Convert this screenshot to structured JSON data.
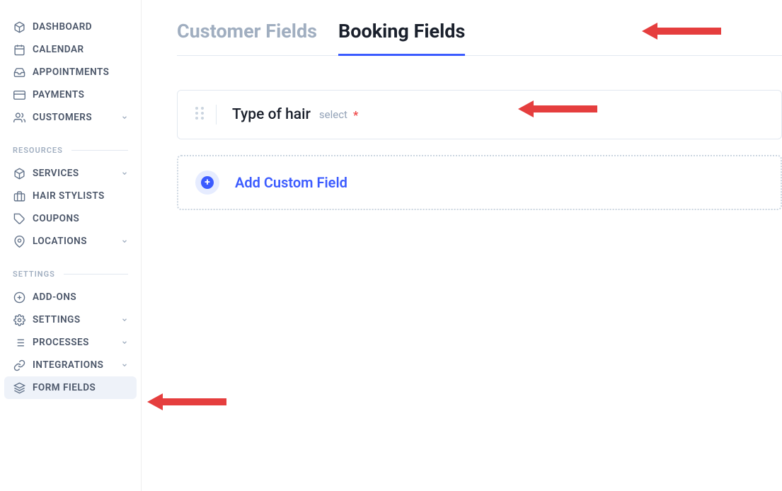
{
  "sidebar": {
    "main": [
      {
        "label": "DASHBOARD",
        "icon": "dashboard"
      },
      {
        "label": "CALENDAR",
        "icon": "calendar"
      },
      {
        "label": "APPOINTMENTS",
        "icon": "appointments"
      },
      {
        "label": "PAYMENTS",
        "icon": "payments"
      },
      {
        "label": "CUSTOMERS",
        "icon": "customers",
        "expandable": true
      }
    ],
    "resources_header": "RESOURCES",
    "resources": [
      {
        "label": "SERVICES",
        "icon": "services",
        "expandable": true
      },
      {
        "label": "HAIR STYLISTS",
        "icon": "staff"
      },
      {
        "label": "COUPONS",
        "icon": "coupons"
      },
      {
        "label": "LOCATIONS",
        "icon": "locations",
        "expandable": true
      }
    ],
    "settings_header": "SETTINGS",
    "settings": [
      {
        "label": "ADD-ONS",
        "icon": "addons"
      },
      {
        "label": "SETTINGS",
        "icon": "settings",
        "expandable": true
      },
      {
        "label": "PROCESSES",
        "icon": "processes",
        "expandable": true
      },
      {
        "label": "INTEGRATIONS",
        "icon": "integrations",
        "expandable": true
      },
      {
        "label": "FORM FIELDS",
        "icon": "formfields",
        "active": true
      }
    ]
  },
  "tabs": {
    "customer": "Customer Fields",
    "booking": "Booking Fields"
  },
  "field": {
    "name": "Type of hair",
    "type": "select",
    "required": "*"
  },
  "add_button": "Add Custom Field"
}
